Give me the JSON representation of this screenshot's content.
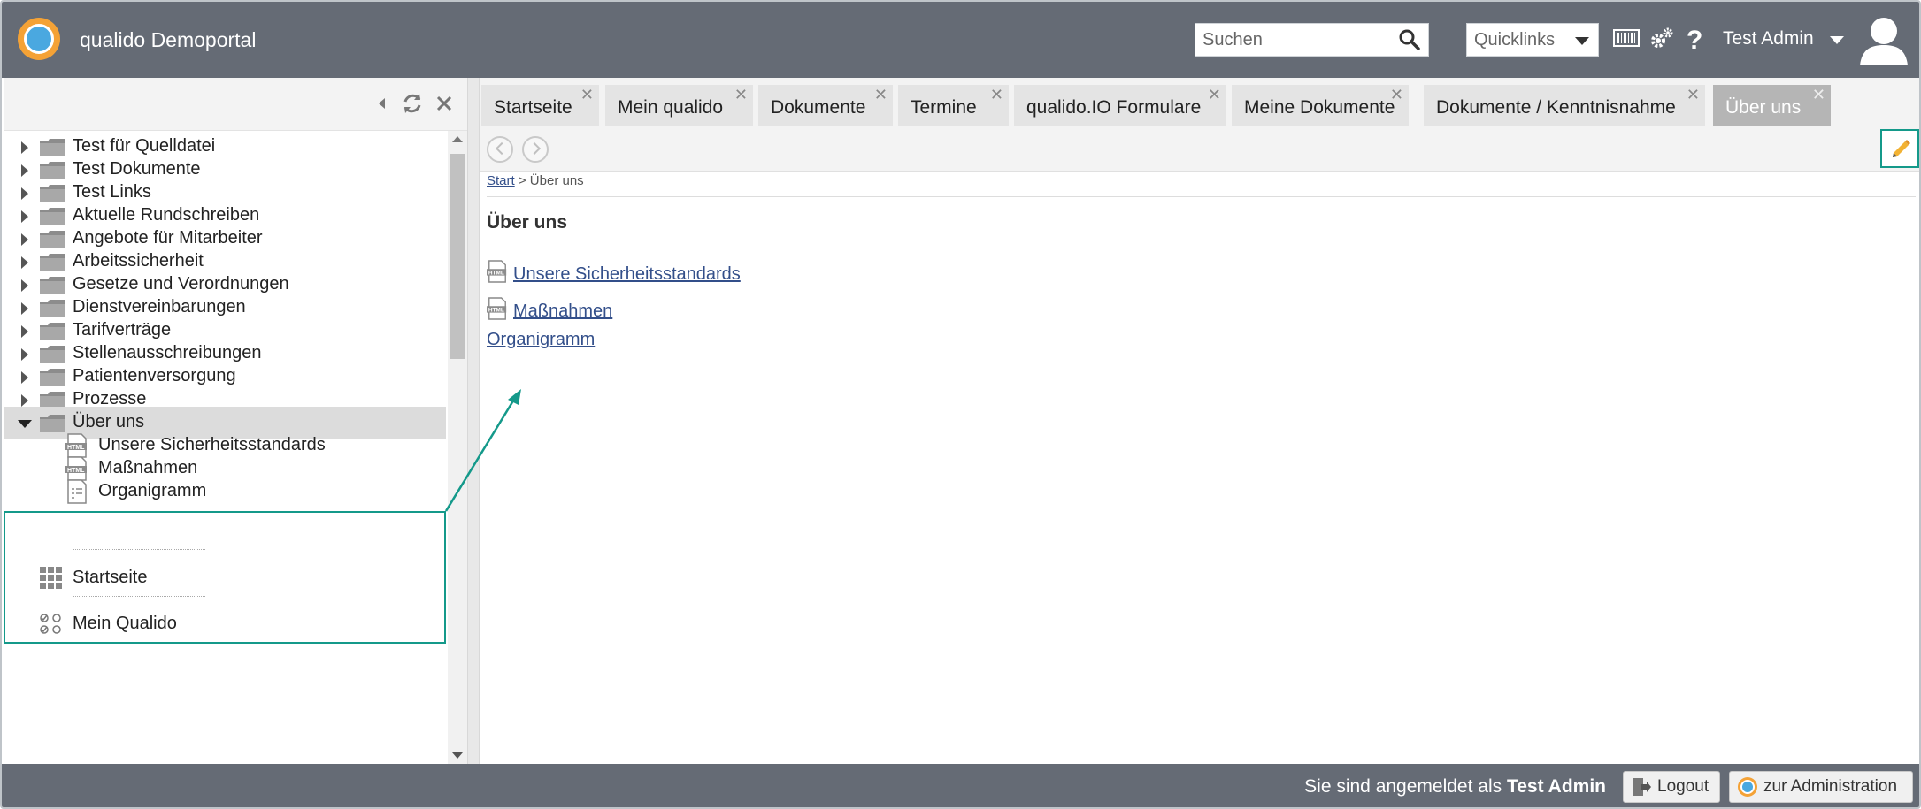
{
  "header": {
    "app_title": "qualido Demoportal",
    "search_placeholder": "Suchen",
    "quicklinks_label": "Quicklinks",
    "user_name": "Test Admin"
  },
  "sidebar": {
    "tree": [
      {
        "label": "Test für Quelldatei",
        "expanded": false
      },
      {
        "label": "Test Dokumente",
        "expanded": false
      },
      {
        "label": "Test Links",
        "expanded": false
      },
      {
        "label": "Aktuelle Rundschreiben",
        "expanded": false
      },
      {
        "label": "Angebote für Mitarbeiter",
        "expanded": false
      },
      {
        "label": "Arbeitssicherheit",
        "expanded": false
      },
      {
        "label": "Gesetze und Verordnungen",
        "expanded": false
      },
      {
        "label": "Dienstvereinbarungen",
        "expanded": false
      },
      {
        "label": "Tarifverträge",
        "expanded": false
      },
      {
        "label": "Stellenausschreibungen",
        "expanded": false
      },
      {
        "label": "Patientenversorgung",
        "expanded": false
      },
      {
        "label": "Prozesse",
        "expanded": false
      },
      {
        "label": "Über uns",
        "expanded": true
      }
    ],
    "children": [
      {
        "label": "Unsere Sicherheitsstandards",
        "icon": "html-doc-icon"
      },
      {
        "label": "Maßnahmen",
        "icon": "html-doc-icon"
      },
      {
        "label": "Organigramm",
        "icon": "form-doc-icon"
      }
    ],
    "nav": [
      {
        "label": "Startseite",
        "icon": "grid-icon"
      },
      {
        "label": "Mein Qualido",
        "icon": "checklist-icon"
      }
    ]
  },
  "tabs": [
    {
      "label": "Startseite",
      "active": false
    },
    {
      "label": "Mein qualido",
      "active": false
    },
    {
      "label": "Dokumente",
      "active": false
    },
    {
      "label": "Termine",
      "active": false
    },
    {
      "label": "qualido.IO Formulare",
      "active": false
    },
    {
      "label": "Meine Dokumente",
      "active": false
    },
    {
      "label": "Dokumente / Kenntnisnahme",
      "active": false
    },
    {
      "label": "Über uns",
      "active": true
    }
  ],
  "main": {
    "breadcrumb_start": "Start",
    "breadcrumb_sep": ">",
    "breadcrumb_current": "Über uns",
    "page_title": "Über uns",
    "links": [
      {
        "label": "Unsere Sicherheitsstandards",
        "has_icon": true
      },
      {
        "label": "Maßnahmen",
        "has_icon": true
      },
      {
        "label": "Organigramm",
        "has_icon": false
      }
    ]
  },
  "footer": {
    "login_prefix": "Sie sind angemeldet als",
    "login_user": "Test Admin",
    "logout_label": "Logout",
    "admin_label": "zur Administration"
  },
  "colors": {
    "header_bg": "#656b75",
    "highlight": "#14998a",
    "link": "#334f8a",
    "active_tab": "#b5b5b5"
  }
}
